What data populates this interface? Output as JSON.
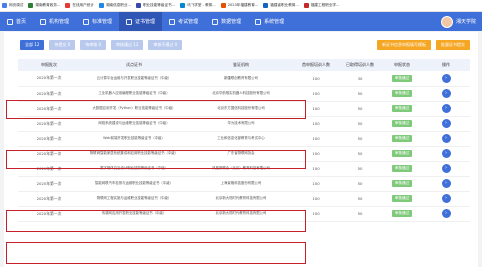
{
  "bookmarks": [
    {
      "label": "网页调试",
      "color": "#4a7de8"
    },
    {
      "label": "湖南教育政务...",
      "color": "#2e7d32"
    },
    {
      "label": "在线用户统计",
      "color": "#e53935"
    },
    {
      "label": "湖南信息职业...",
      "color": "#1e88e5"
    },
    {
      "label": "职业技能等级证书...",
      "color": "#3949ab"
    },
    {
      "label": "讯飞学堂 - 教育...",
      "color": "#0288d1"
    },
    {
      "label": "2023年福建教育...",
      "color": "#e65100"
    },
    {
      "label": "福建省职业教育...",
      "color": "#1565c0"
    },
    {
      "label": "福建工程职业学...",
      "color": "#c62828"
    }
  ],
  "nav": {
    "items": [
      {
        "label": "首页"
      },
      {
        "label": "机构管理"
      },
      {
        "label": "标准管理"
      },
      {
        "label": "证书管理"
      },
      {
        "label": "考试管理"
      },
      {
        "label": "数据管理"
      },
      {
        "label": "系统管理"
      }
    ],
    "user": "湘天学院"
  },
  "tabs": [
    "全部 12",
    "待提交 0",
    "待审核 0",
    "审核通过 12",
    "审核不通过 0"
  ],
  "actions": [
    "新证书信息申报填写模板",
    "批量证书提交"
  ],
  "table": {
    "headers": [
      "申报批次",
      "试点证书",
      "鉴证机构",
      "首申报培训人数",
      "已取得培训人数",
      "申报状态",
      "操作"
    ],
    "rows": [
      {
        "batch": "2020年第一次",
        "cert": "云计算平台运维与开发职业技能等级证书（中级）",
        "org": "新疆联创教育有限公司",
        "a": "100",
        "b": "30",
        "status": "审核通过"
      },
      {
        "batch": "2020年第一次",
        "cert": "工业机器人应用编程职业技能等级证书（中级）",
        "org": "北京华航唯实机器人科技股份有限公司",
        "a": "100",
        "b": "50",
        "status": "审核通过"
      },
      {
        "batch": "2020年第一次",
        "cert": "大数据应用开发（Python）职业技能等级证书（中级）",
        "org": "北京东方国信科技股份有限公司",
        "a": "100",
        "b": "50",
        "status": "审核通过"
      },
      {
        "batch": "2020年第一次",
        "cert": "网络系统建设与运维职业技能等级证书（中级）",
        "org": "华为技术有限公司",
        "a": "100",
        "b": "50",
        "status": "审核通过"
      },
      {
        "batch": "2020年第一次",
        "cert": "Web前端开发职业技能等级证书（中级）",
        "org": "工业和信息化部教育与考试中心",
        "a": "100",
        "b": "50",
        "status": "审核通过"
      },
      {
        "batch": "2020年第一次",
        "cert": "物联网智能家居系统集成和应用职业技能等级证书（中级）",
        "org": "广东省物联网协会",
        "a": "100",
        "b": "50",
        "status": "审核通过"
      },
      {
        "batch": "2020年第一次",
        "cert": "数字媒体交互设计职业技能等级证书（中级）",
        "org": "凤凰新联合（北京）教育科技有限公司",
        "a": "100",
        "b": "50",
        "status": "审核通过"
      },
      {
        "batch": "2020年第一次",
        "cert": "智能网联汽车检测与运维职业技能等级证书（中级）",
        "org": "上海景格科技股份有限公司",
        "a": "100",
        "b": "50",
        "status": "审核通过"
      },
      {
        "batch": "2020年第一次",
        "cert": "物联网工程实施与运维职业技能等级证书（中级）",
        "org": "北京新大陆时代教育科技有限公司",
        "a": "100",
        "b": "50",
        "status": "审核通过"
      },
      {
        "batch": "2020年第一次",
        "cert": "传感网应用开发职业技能等级证书（中级）",
        "org": "北京新大陆时代教育科技有限公司",
        "a": "100",
        "b": "50",
        "status": "审核通过"
      }
    ]
  }
}
